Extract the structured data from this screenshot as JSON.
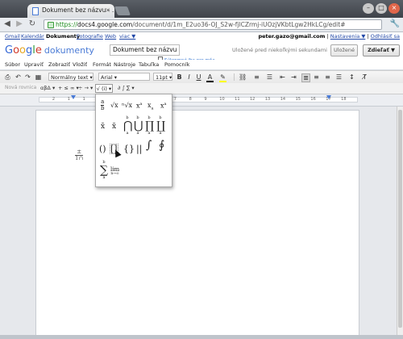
{
  "browser": {
    "tab_title": "Dokument bez názvu - ...",
    "tab_close": "×",
    "win_min": "–",
    "win_max": "□",
    "win_close": "×",
    "url_scheme": "https://",
    "url_host": "docs4.google.com",
    "url_path": "/document/d/1m_E2uo36-OJ_S2w-fjlCZrmj-iUOzjVKbtLgw2HkLCg/edit#"
  },
  "gbar": {
    "links": [
      "Gmail",
      "Kalendár",
      "Dokumenty",
      "Fotografie",
      "Web",
      "viac ▼"
    ],
    "email": "peter.gazo@gmail.com",
    "settings": "Nastavenia ▼",
    "signout": "Odhlásiť sa"
  },
  "header": {
    "logo_google": "Google",
    "logo_product": "dokumenty",
    "doc_title": "Dokument bez názvu",
    "private_note": "Súkromné iba pre mňa",
    "saved_status": "Uložené pred niekoľkými sekundami",
    "save_button": "Uložené",
    "share_button": "Zdieľať ▼"
  },
  "menu": [
    "Súbor",
    "Upraviť",
    "Zobraziť",
    "Vložiť",
    "Formát",
    "Nástroje",
    "Tabuľka",
    "Pomocník"
  ],
  "toolbar": {
    "style_select": "Normálny text",
    "font_select": "Arial",
    "size_select": "11pt",
    "bold": "B",
    "italic": "I",
    "underline": "U",
    "text_color": "A",
    "highlight": "✎"
  },
  "eqtoolbar": {
    "new_eq": "Nová rovnica",
    "groups": [
      "αβΔ ▾",
      "+ ≤ ∞ ▾",
      "÷ → ▾",
      "√ (i) ▾",
      "∂ ∫ ∑ ▾"
    ]
  },
  "ruler": {
    "numbers": [
      "2",
      "1",
      "1",
      "2",
      "3",
      "4",
      "5",
      "6",
      "7",
      "8",
      "9",
      "10",
      "11",
      "12",
      "13",
      "14",
      "15",
      "16",
      "17",
      "18"
    ]
  },
  "palette": {
    "frac_a": "a",
    "frac_b": "b",
    "sqrt": "√x",
    "nroot": "ⁿ√x",
    "xsup": "x",
    "sup_n": "a",
    "xsub": "x",
    "sub_n": "a",
    "xsupsub": "x",
    "bar": "x̄",
    "tilde": "x̃",
    "bigcap": "⋂",
    "bigcup": "⋃",
    "prod": "∏",
    "coprod": "∐",
    "lim_b": "b",
    "lim_a": "a",
    "paren": "()",
    "bracket": "[]",
    "brace": "{}",
    "abs": "||",
    "integral": "∫",
    "contour": "∮",
    "sum": "∑",
    "lim": "lim",
    "lim_sub": "n→∞"
  },
  "doc": {
    "cursor_top": "±",
    "cursor_bottom": "1∩"
  }
}
